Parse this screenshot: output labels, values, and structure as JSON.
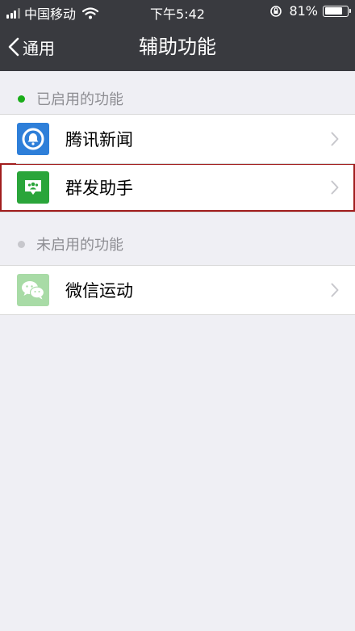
{
  "status_bar": {
    "carrier": "中国移动",
    "time": "下午5:42",
    "battery_text": "81%",
    "battery_level": 0.81
  },
  "nav": {
    "back_label": "通用",
    "title": "辅助功能"
  },
  "sections": [
    {
      "header": "已启用的功能",
      "dot_color": "#1aad19",
      "items": [
        {
          "label": "腾讯新闻",
          "icon": "tencent-news-icon",
          "icon_color": "#2e7fd9"
        },
        {
          "label": "群发助手",
          "icon": "group-broadcast-icon",
          "icon_color": "#2aa53a"
        }
      ]
    },
    {
      "header": "未启用的功能",
      "dot_color": "#c7c7cc",
      "items": [
        {
          "label": "微信运动",
          "icon": "wechat-sport-icon",
          "icon_color": "#a8dba6"
        }
      ]
    }
  ],
  "colors": {
    "nav_bg": "#393a3f",
    "page_bg": "#efeff4",
    "highlight_border": "#a11d1d"
  }
}
